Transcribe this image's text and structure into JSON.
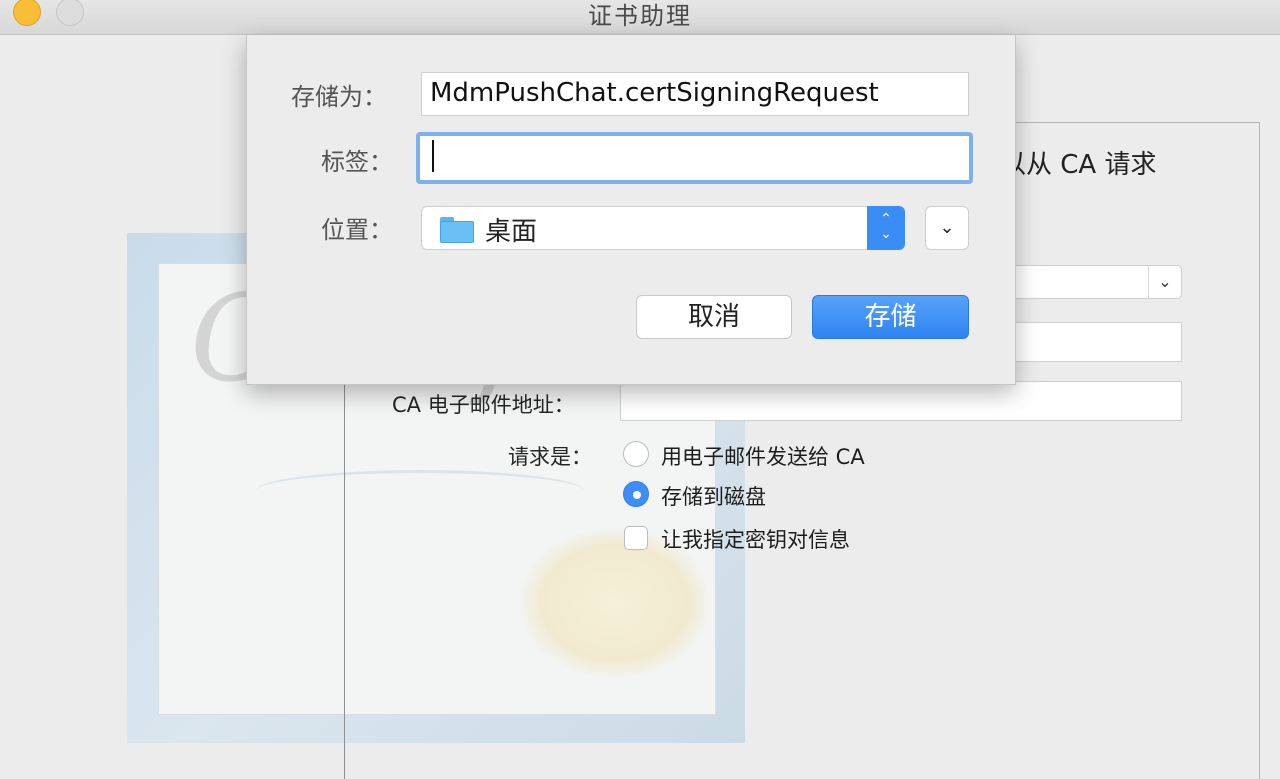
{
  "window": {
    "title": "证书助理",
    "traffic_lights": [
      "close",
      "minimize"
    ]
  },
  "background_form": {
    "partial_heading": "以从 CA 请求",
    "ca_email_label": "CA 电子邮件地址：",
    "request_label": "请求是：",
    "options": [
      {
        "label": "用电子邮件发送给 CA",
        "selected": false
      },
      {
        "label": "存储到磁盘",
        "selected": true
      }
    ],
    "checkbox": {
      "label": "让我指定密钥对信息",
      "checked": false
    },
    "dropdown_chevron": "chevron-down-icon"
  },
  "certificate_art": {
    "script_text": "Certif"
  },
  "save_sheet": {
    "save_as_label": "存储为：",
    "save_as_value": "MdmPushChat.certSigningRequest",
    "tags_label": "标签：",
    "tags_value": "",
    "location_label": "位置：",
    "location_value": "桌面",
    "cancel_label": "取消",
    "save_label": "存储"
  },
  "colors": {
    "accent_blue": "#3b8df6",
    "focus_ring": "#7fb0ee",
    "close_yellow": "#f8be37"
  }
}
